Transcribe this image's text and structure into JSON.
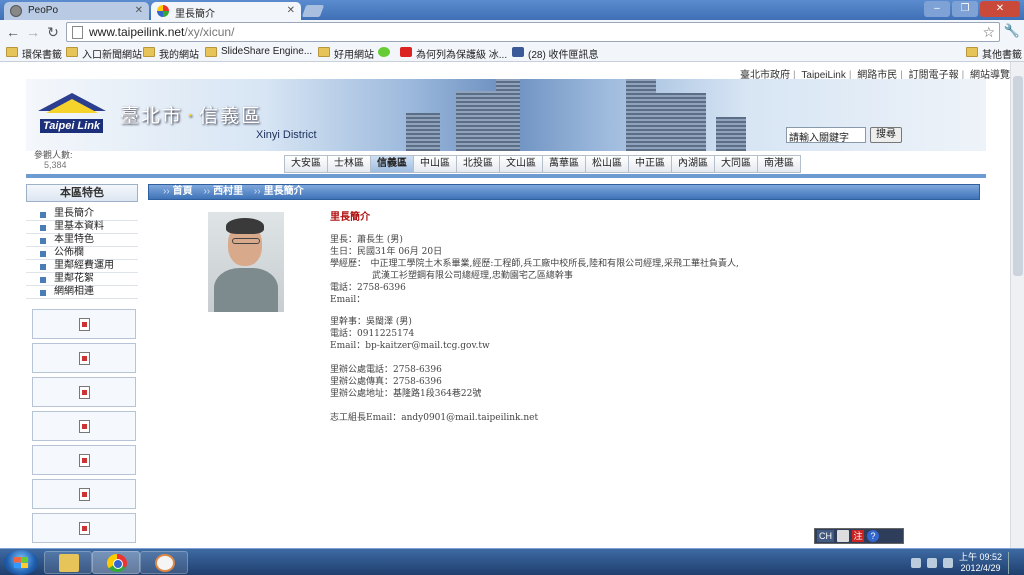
{
  "browser": {
    "tabs": [
      {
        "label": "PeoPo",
        "active": false
      },
      {
        "label": "里長簡介",
        "active": true
      }
    ],
    "url_host": "www.taipeilink.net",
    "url_path": "/xy/xicun/",
    "bookmarks": [
      {
        "label": "環保書籤",
        "icon": "folder-icon"
      },
      {
        "label": "入口新聞網站",
        "icon": "folder-icon"
      },
      {
        "label": "我的網站",
        "icon": "folder-icon"
      },
      {
        "label": "SlideShare Engine...",
        "icon": "folder-icon"
      },
      {
        "label": "好用網站",
        "icon": "folder-icon"
      },
      {
        "label": "",
        "icon": "ie-icon"
      },
      {
        "label": "為何列為保護級 冰...",
        "icon": "youtube-icon"
      },
      {
        "label": "(28) 收件匣訊息",
        "icon": "facebook-icon"
      }
    ],
    "other_bookmarks": "其他書籤"
  },
  "site": {
    "top_links": [
      "臺北市政府",
      "TaipeiLink",
      "網路市民",
      "訂閱電子報",
      "網站導覽"
    ],
    "logo_text": "Taipei Link",
    "city_title": "臺北市",
    "district_title": "信義區",
    "district_en": "Xinyi District",
    "search_placeholder": "請輸入關鍵字",
    "search_button": "搜尋",
    "visitors_label": "參觀人數:",
    "visitors_count": "5,384",
    "districts": [
      {
        "label": "大安區",
        "active": false
      },
      {
        "label": "士林區",
        "active": false
      },
      {
        "label": "信義區",
        "active": true
      },
      {
        "label": "中山區",
        "active": false
      },
      {
        "label": "北投區",
        "active": false
      },
      {
        "label": "文山區",
        "active": false
      },
      {
        "label": "萬華區",
        "active": false
      },
      {
        "label": "松山區",
        "active": false
      },
      {
        "label": "中正區",
        "active": false
      },
      {
        "label": "內湖區",
        "active": false
      },
      {
        "label": "大同區",
        "active": false
      },
      {
        "label": "南港區",
        "active": false
      }
    ]
  },
  "sidebar": {
    "heading": "本區特色",
    "items": [
      "里長簡介",
      "里基本資料",
      "本里特色",
      "公佈欄",
      "里鄰經費運用",
      "里鄰花絮",
      "網網相連"
    ]
  },
  "breadcrumb": [
    "首頁",
    "西村里",
    "里長簡介"
  ],
  "content": {
    "heading": "里長簡介",
    "chief": {
      "name": "里長：蕭長生 (男)",
      "birth": "生日：民國31年 06月 20日",
      "edu1": "學經歷：　中正理工學院土木系畢業,經歷:工程師,兵工廠中校所長,陸和有限公司經理,采飛工華社負責人,",
      "edu2": "武漢工衫塑鋼有限公司總經理,忠勤園宅乙區總幹事",
      "phone": "電話：2758-6396",
      "email": "Email："
    },
    "secretary": {
      "name": "里幹事：吳閩澤 (男)",
      "phone": "電話：0911225174",
      "email": "Email：bp-kaitzer@mail.tcg.gov.tw"
    },
    "office": {
      "phone": "里辦公處電話：2758-6396",
      "fax": "里辦公處傳真：2758-6396",
      "address": "里辦公處地址：基隆路1段364巷22號"
    },
    "volunteer": "志工組長Email：andy0901@mail.taipeilink.net"
  },
  "ime": {
    "lang": "CH"
  },
  "taskbar": {
    "time": "上午 09:52",
    "date": "2012/4/29"
  }
}
